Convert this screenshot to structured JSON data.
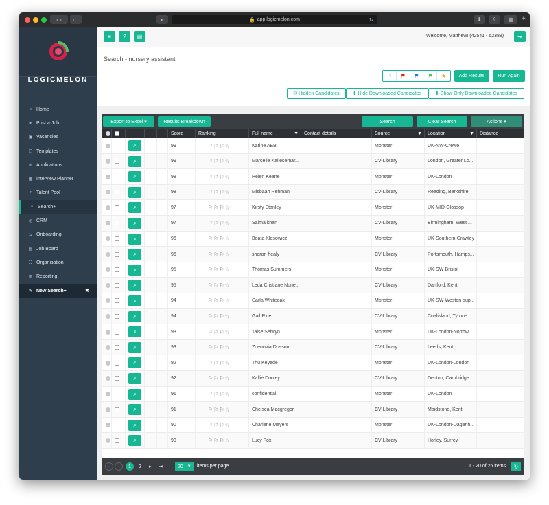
{
  "browser": {
    "url": "app.logicmelon.com"
  },
  "brand": {
    "name": "LOGICMELON"
  },
  "nav": [
    {
      "icon": "home-icon",
      "glyph": "⌂",
      "label": "Home"
    },
    {
      "icon": "megaphone-icon",
      "glyph": "✈",
      "label": "Post a Job"
    },
    {
      "icon": "briefcase-icon",
      "glyph": "▣",
      "label": "Vacancies"
    },
    {
      "icon": "templates-icon",
      "glyph": "❐",
      "label": "Templates"
    },
    {
      "icon": "envelope-icon",
      "glyph": "✉",
      "label": "Applications"
    },
    {
      "icon": "calendar-icon",
      "glyph": "▦",
      "label": "Interview Planner"
    },
    {
      "icon": "search-icon",
      "glyph": "⌕",
      "label": "Talent Pool"
    },
    {
      "icon": "search-plus-icon",
      "glyph": "⌕",
      "label": "Search+"
    },
    {
      "icon": "crm-icon",
      "glyph": "◎",
      "label": "CRM"
    },
    {
      "icon": "onboarding-icon",
      "glyph": "⇆",
      "label": "Onboarding"
    },
    {
      "icon": "job-board-icon",
      "glyph": "▤",
      "label": "Job Board"
    },
    {
      "icon": "organisation-icon",
      "glyph": "☷",
      "label": "Organisation"
    },
    {
      "icon": "reporting-icon",
      "glyph": "▥",
      "label": "Reporting"
    },
    {
      "icon": "edit-icon",
      "glyph": "✎",
      "label": "New Search+"
    }
  ],
  "header": {
    "welcome": "Welcome, Matthew! (42541 - 62388)"
  },
  "page": {
    "title": "Search - nursery assistant"
  },
  "actions": {
    "add_results": "Add Results",
    "run_again": "Run Again",
    "hidden": "✉ Hidden Candidates",
    "hide_downloaded": "⬇ Hide Downloaded Candidates",
    "show_downloaded": "⬇ Show Only Downloaded Candidates"
  },
  "grid_toolbar": {
    "export": "Export to Excel ▾",
    "breakdown": "Results Breakdown",
    "search": "Search",
    "clear": "Clear Search",
    "actions": "Actions ▾"
  },
  "columns": [
    "Score",
    "Ranking",
    "Full name",
    "Contact details",
    "Source",
    "Location",
    "Distance"
  ],
  "rows": [
    {
      "score": "99",
      "name": "Karine AEBI",
      "source": "Monster",
      "location": "UK-NW-Crewe"
    },
    {
      "score": "99",
      "name": "Marcelle Kaliesemar...",
      "source": "CV-Library",
      "location": "London, Greater Lo..."
    },
    {
      "score": "98",
      "name": "Helen Keane",
      "source": "Monster",
      "location": "UK-London"
    },
    {
      "score": "98",
      "name": "Misbaah Rehman",
      "source": "CV-Library",
      "location": "Reading, Berkshire"
    },
    {
      "score": "97",
      "name": "Kirsty Stanley",
      "source": "Monster",
      "location": "UK-MID-Glossop"
    },
    {
      "score": "97",
      "name": "Salma khan",
      "source": "CV-Library",
      "location": "Birmingham, West ..."
    },
    {
      "score": "96",
      "name": "Beata Klosowicz",
      "source": "Monster",
      "location": "UK-Southern-Crawley"
    },
    {
      "score": "96",
      "name": "sharon healy",
      "source": "CV-Library",
      "location": "Portsmouth, Hamps..."
    },
    {
      "score": "95",
      "name": "Thomas Summers",
      "source": "Monster",
      "location": "UK-SW-Bristol"
    },
    {
      "score": "95",
      "name": "Leda Cristiane Nune...",
      "source": "CV-Library",
      "location": "Dartford, Kent"
    },
    {
      "score": "94",
      "name": "Carla Whiteoak",
      "source": "Monster",
      "location": "UK-SW-Weston-sup..."
    },
    {
      "score": "94",
      "name": "Gail Rice",
      "source": "CV-Library",
      "location": "Coalisland, Tyrone"
    },
    {
      "score": "93",
      "name": "Taise Selwyn",
      "source": "Monster",
      "location": "UK-London-Northw..."
    },
    {
      "score": "93",
      "name": "Zoenovia Dossou",
      "source": "CV-Library",
      "location": "Leeds, Kent"
    },
    {
      "score": "92",
      "name": "Thu Keyede",
      "source": "Monster",
      "location": "UK-London-London"
    },
    {
      "score": "92",
      "name": "Kallie Dooley",
      "source": "CV-Library",
      "location": "Denton, Cambridge..."
    },
    {
      "score": "91",
      "name": "confidential",
      "source": "Monster",
      "location": "UK-London"
    },
    {
      "score": "91",
      "name": "Chelsea Macgregor",
      "source": "CV-Library",
      "location": "Maidstone, Kent"
    },
    {
      "score": "90",
      "name": "Charlene Mayers",
      "source": "Monster",
      "location": "UK-London-Dagenh..."
    },
    {
      "score": "90",
      "name": "Lucy Fox",
      "source": "CV-Library",
      "location": "Horley, Surrey"
    }
  ],
  "ranking_glyphs": "⚐⚐⚐☆",
  "pager": {
    "pages": [
      "1",
      "2"
    ],
    "page_size": "20",
    "per_page_label": "items per page",
    "summary": "1 - 20 of 26 items"
  }
}
